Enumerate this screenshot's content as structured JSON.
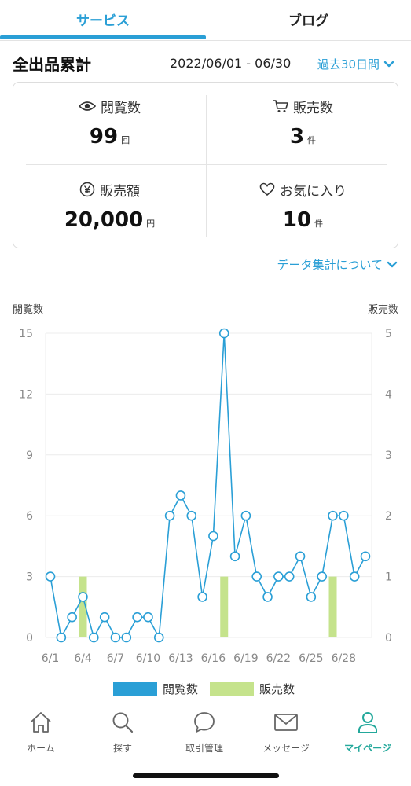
{
  "tabs": {
    "service": "サービス",
    "blog": "ブログ"
  },
  "summary": {
    "title": "全出品累計",
    "period": "2022/06/01 - 06/30",
    "range_select": "過去30日間"
  },
  "stats": {
    "views": {
      "label": "閲覧数",
      "value": "99",
      "unit": "回"
    },
    "sales_count": {
      "label": "販売数",
      "value": "3",
      "unit": "件"
    },
    "sales_amount": {
      "label": "販売額",
      "value": "20,000",
      "unit": "円"
    },
    "favorites": {
      "label": "お気に入り",
      "value": "10",
      "unit": "件"
    }
  },
  "about_link": "データ集計について",
  "colors": {
    "accent": "#2a9fd6",
    "bar": "#c5e38c",
    "active_nav": "#23a89b"
  },
  "chart_data": {
    "type": "line",
    "ylabel_left": "閲覧数",
    "ylabel_right": "販売数",
    "x": [
      "6/1",
      "6/2",
      "6/3",
      "6/4",
      "6/5",
      "6/6",
      "6/7",
      "6/8",
      "6/9",
      "6/10",
      "6/11",
      "6/12",
      "6/13",
      "6/14",
      "6/15",
      "6/16",
      "6/17",
      "6/18",
      "6/19",
      "6/20",
      "6/21",
      "6/22",
      "6/23",
      "6/24",
      "6/25",
      "6/26",
      "6/27",
      "6/28",
      "6/29",
      "6/30"
    ],
    "xticks": [
      "6/1",
      "6/4",
      "6/7",
      "6/10",
      "6/13",
      "6/16",
      "6/19",
      "6/22",
      "6/25",
      "6/28"
    ],
    "yticks_left": [
      0,
      3,
      6,
      9,
      12,
      15
    ],
    "yticks_right": [
      0,
      1,
      2,
      3,
      4,
      5
    ],
    "ylim_left": [
      0,
      15
    ],
    "ylim_right": [
      0,
      5
    ],
    "series": [
      {
        "name": "閲覧数",
        "type": "line",
        "axis": "left",
        "color": "#2a9fd6",
        "values": [
          3,
          0,
          1,
          2,
          0,
          1,
          0,
          0,
          1,
          1,
          0,
          6,
          7,
          6,
          2,
          5,
          15,
          4,
          6,
          3,
          2,
          3,
          3,
          4,
          2,
          3,
          6,
          6,
          3,
          4
        ]
      },
      {
        "name": "販売数",
        "type": "bar",
        "axis": "right",
        "color": "#c5e38c",
        "values": [
          0,
          0,
          0,
          1,
          0,
          0,
          0,
          0,
          0,
          0,
          0,
          0,
          0,
          0,
          0,
          0,
          1,
          0,
          0,
          0,
          0,
          0,
          0,
          0,
          0,
          0,
          1,
          0,
          0,
          0
        ]
      }
    ],
    "legend": "bottom"
  },
  "nav": {
    "items": [
      {
        "label": "ホーム",
        "icon": "home-icon"
      },
      {
        "label": "探す",
        "icon": "search-icon"
      },
      {
        "label": "取引管理",
        "icon": "chat-bubble-icon"
      },
      {
        "label": "メッセージ",
        "icon": "mail-icon"
      },
      {
        "label": "マイページ",
        "icon": "person-icon"
      }
    ]
  }
}
